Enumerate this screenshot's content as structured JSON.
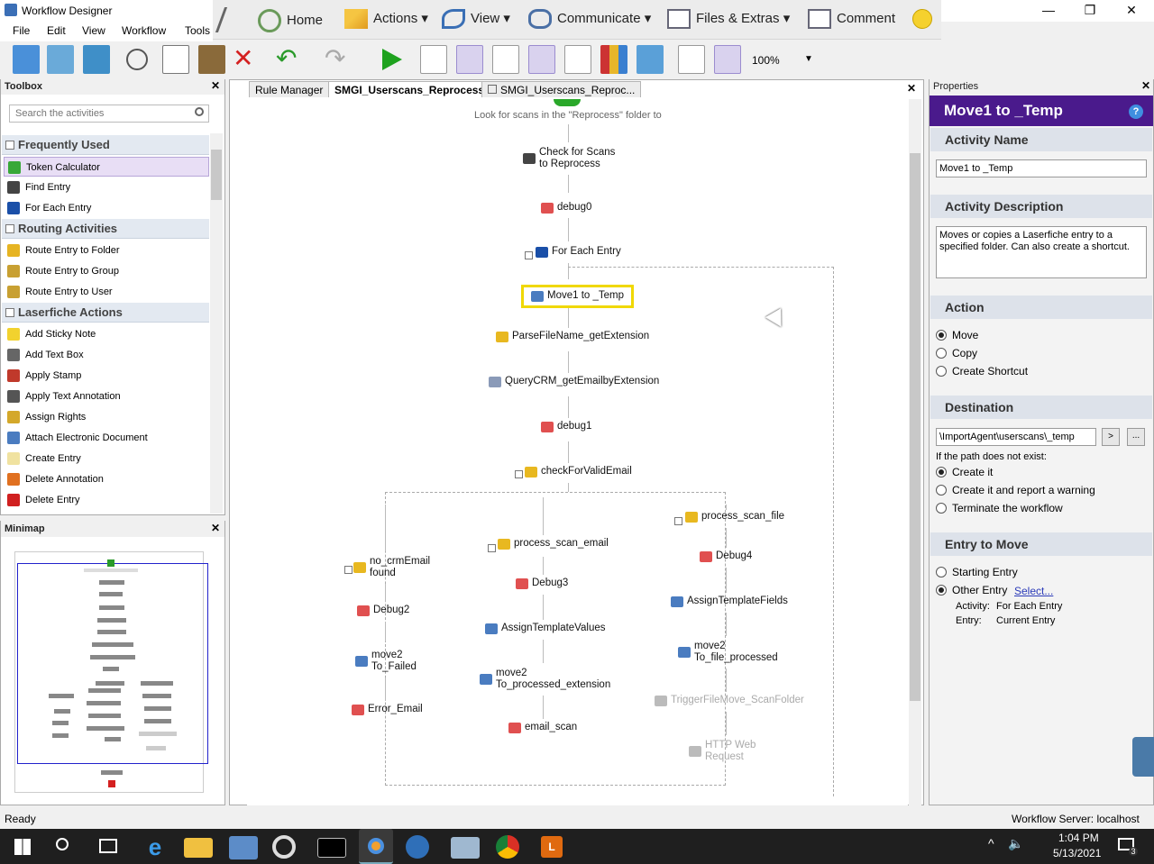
{
  "window": {
    "title": "Workflow Designer",
    "minimize": "—",
    "restore": "❐",
    "close": "✕"
  },
  "menu": [
    "File",
    "Edit",
    "View",
    "Workflow",
    "Tools"
  ],
  "ribbon": {
    "home": "Home",
    "actions": "Actions",
    "view": "View",
    "communicate": "Communicate",
    "files": "Files & Extras",
    "comment": "Comment"
  },
  "toolbar": {
    "zoom": "100%"
  },
  "toolbox": {
    "title": "Toolbox",
    "search_placeholder": "Search the activities",
    "groups": [
      {
        "label": "Frequently Used",
        "items": [
          {
            "label": "Token Calculator",
            "icon": "plus-icon",
            "color": "#38a838"
          },
          {
            "label": "Find Entry",
            "icon": "binoculars-icon",
            "color": "#444"
          },
          {
            "label": "For Each Entry",
            "icon": "loop-icon",
            "color": "#1a4fa8"
          }
        ]
      },
      {
        "label": "Routing Activities",
        "items": [
          {
            "label": "Route Entry to Folder",
            "icon": "folder-icon",
            "color": "#e6b422"
          },
          {
            "label": "Route Entry to Group",
            "icon": "group-icon",
            "color": "#c8a032"
          },
          {
            "label": "Route Entry to User",
            "icon": "user-icon",
            "color": "#c8a032"
          }
        ]
      },
      {
        "label": "Laserfiche Actions",
        "items": [
          {
            "label": "Add Sticky Note",
            "icon": "sticky-note-icon",
            "color": "#f2d22e"
          },
          {
            "label": "Add Text Box",
            "icon": "text-box-icon",
            "color": "#666"
          },
          {
            "label": "Apply Stamp",
            "icon": "stamp-icon",
            "color": "#c0392b"
          },
          {
            "label": "Apply Text Annotation",
            "icon": "annotation-icon",
            "color": "#555"
          },
          {
            "label": "Assign Rights",
            "icon": "rights-icon",
            "color": "#d4a82a"
          },
          {
            "label": "Attach Electronic Document",
            "icon": "attach-icon",
            "color": "#4a7cc0"
          },
          {
            "label": "Create Entry",
            "icon": "create-entry-icon",
            "color": "#f0e2a0"
          },
          {
            "label": "Delete Annotation",
            "icon": "delete-annotation-icon",
            "color": "#e07020"
          },
          {
            "label": "Delete Entry",
            "icon": "delete-icon",
            "color": "#d02020"
          }
        ]
      }
    ]
  },
  "minimap": {
    "title": "Minimap"
  },
  "tabs": [
    "Rule Manager",
    "SMGI_Userscans_Reprocess*",
    "SMGI_Userscans_Reproc..."
  ],
  "canvas": {
    "header_text": "Look for scans in the \"Reprocess\" folder to",
    "nodes": {
      "check": "Check for Scans\nto Reprocess",
      "debug0": "debug0",
      "foreach": "For Each Entry",
      "move1": "Move1 to _Temp",
      "parse": "ParseFileName_getExtension",
      "query": "QueryCRM_getEmailbyExtension",
      "debug1": "debug1",
      "check_valid": "checkForValidEmail",
      "no_crm": "no_crmEmail\nfound",
      "debug2": "Debug2",
      "move2_failed": "move2\nTo_Failed",
      "error_email": "Error_Email",
      "process_email": "process_scan_email",
      "debug3": "Debug3",
      "assign_values": "AssignTemplateValues",
      "move2_ext": "move2\nTo_processed_extension",
      "email_scan": "email_scan",
      "process_file": "process_scan_file",
      "debug4": "Debug4",
      "assign_fields": "AssignTemplateFields",
      "move2_file": "move2\nTo_file_processed",
      "trigger": "TriggerFileMove_ScanFolder",
      "http": "HTTP Web\nRequest"
    }
  },
  "properties": {
    "pane_title": "Properties",
    "title": "Move1 to _Temp",
    "help": "?",
    "activity_name_label": "Activity Name",
    "activity_name": "Move1 to _Temp",
    "description_label": "Activity Description",
    "description": "Moves or copies a Laserfiche entry to a specified folder.  Can also create a shortcut.",
    "action_label": "Action",
    "actions": [
      {
        "label": "Move",
        "checked": true
      },
      {
        "label": "Copy",
        "checked": false
      },
      {
        "label": "Create Shortcut",
        "checked": false
      }
    ],
    "destination_label": "Destination",
    "destination": "\\ImportAgent\\userscans\\_temp",
    "browse": "...",
    "path_note": "If the path does not exist:",
    "path_options": [
      {
        "label": "Create it",
        "checked": true
      },
      {
        "label": "Create it and report a warning",
        "checked": false
      },
      {
        "label": "Terminate the workflow",
        "checked": false
      }
    ],
    "entry_label": "Entry to Move",
    "entry_options": [
      {
        "label": "Starting Entry",
        "checked": false
      },
      {
        "label": "Other Entry",
        "checked": true
      }
    ],
    "select_link": "Select...",
    "activity_key": "Activity:",
    "activity_value": "For Each Entry",
    "entry_key": "Entry:",
    "entry_value": "Current Entry"
  },
  "status": {
    "left": "Ready",
    "right": "Workflow Server: localhost"
  },
  "taskbar": {
    "time": "1:04 PM",
    "date": "5/13/2021",
    "notifications": "3"
  }
}
